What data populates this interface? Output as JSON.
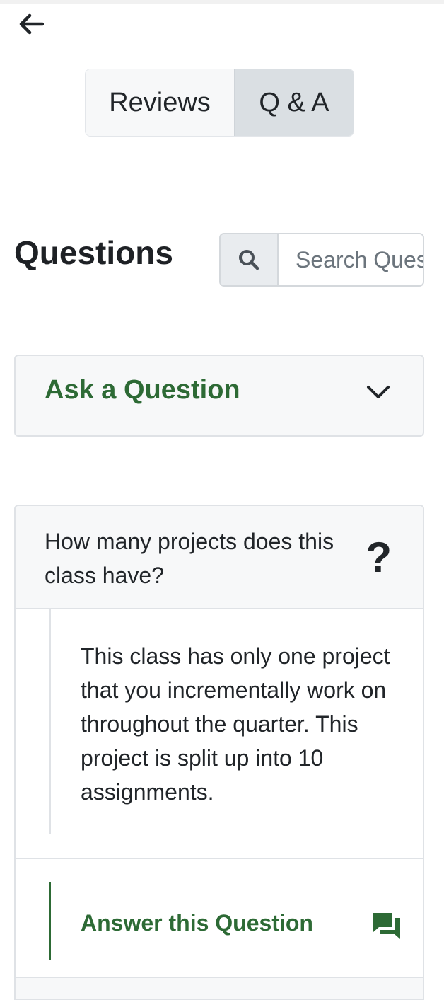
{
  "nav": {
    "back_icon": "arrow-left-icon"
  },
  "tabs": [
    {
      "label": "Reviews",
      "active": false
    },
    {
      "label": "Q & A",
      "active": true
    }
  ],
  "questions": {
    "title": "Questions",
    "search": {
      "icon": "search-icon",
      "placeholder": "Search Questions",
      "value": ""
    }
  },
  "ask": {
    "label": "Ask a Question",
    "icon": "chevron-down-icon"
  },
  "question_card": {
    "question": "How many projects does this class have?",
    "question_icon": "question-mark-icon",
    "answer": "This class has only one project that you incrementally work on throughout the quarter. This project is split up into 10 assignments.",
    "answer_action_label": "Answer this Question",
    "answer_action_icon": "chat-icon"
  },
  "colors": {
    "accent_green": "#2d6a35",
    "tab_active_bg": "#dadfe3",
    "card_bg": "#f7f8f9",
    "border": "#dfe2e6"
  }
}
